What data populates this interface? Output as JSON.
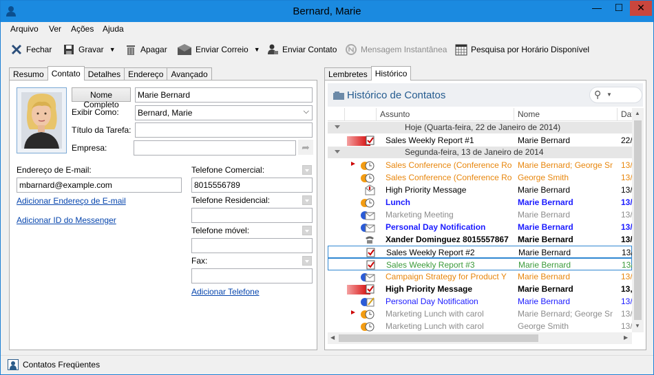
{
  "window": {
    "title": "Bernard, Marie",
    "minimize": "—",
    "maximize": "☐",
    "close": "✕"
  },
  "menu": [
    "Arquivo",
    "Ver",
    "Ações",
    "Ajuda"
  ],
  "toolbar": {
    "close": "Fechar",
    "save": "Gravar",
    "delete": "Apagar",
    "send_mail": "Enviar Correio",
    "send_contact": "Enviar Contato",
    "instant_message": "Mensagem Instantânea",
    "free_busy": "Pesquisa por Horário Disponível"
  },
  "left_tabs": [
    "Resumo",
    "Contato",
    "Detalhes",
    "Endereço",
    "Avançado"
  ],
  "contact": {
    "full_name_button": "Nome Completo",
    "full_name": "Marie Bernard",
    "display_as_label": "Exibir Como:",
    "display_as": "Bernard, Marie",
    "job_title_label": "Título da Tarefa:",
    "job_title": "",
    "company_label": "Empresa:",
    "company": "",
    "email_label": "Endereço de E-mail:",
    "email": "mbarnard@example.com",
    "add_email_link": "Adicionar Endereço de E-mail",
    "add_messenger_link": "Adicionar ID do Messenger",
    "business_phone_label": "Telefone Comercial:",
    "business_phone": "8015556789",
    "home_phone_label": "Telefone Residencial:",
    "home_phone": "",
    "mobile_phone_label": "Telefone móvel:",
    "mobile_phone": "",
    "fax_label": "Fax:",
    "fax": "",
    "add_phone_link": "Adicionar Telefone"
  },
  "right_tabs": [
    "Lembretes",
    "Histórico"
  ],
  "history": {
    "title": "Histórico de Contatos",
    "columns": {
      "subject": "Assunto",
      "name": "Nome",
      "date": "Dat"
    },
    "groups": [
      {
        "label": "Hoje (Quarta-feira, 22 de Janeiro de 2014)",
        "rows": [
          {
            "subject": "Sales Weekly Report #1",
            "name": "Marie Bernard",
            "date": "22/",
            "color": "#000000",
            "bold": false,
            "icon": "flag-task-icon"
          }
        ]
      },
      {
        "label": "Segunda-feira, 13 de Janeiro de 2014",
        "rows": [
          {
            "subject": "Sales Conference (Conference Roc",
            "name": "Marie Bernard;  George Sm",
            "date": "13/",
            "color": "#e8860c",
            "bold": false,
            "icon": "recurring-meeting-icon"
          },
          {
            "subject": "Sales Conference (Conference Roc",
            "name": "George Smith",
            "date": "13/",
            "color": "#e8860c",
            "bold": false,
            "icon": "meeting-icon"
          },
          {
            "subject": "High Priority Message",
            "name": "Marie Bernard",
            "date": "13/",
            "color": "#000000",
            "bold": false,
            "icon": "high-priority-mail-icon"
          },
          {
            "subject": "Lunch",
            "name": "Marie Bernard",
            "date": "13/",
            "color": "#1a1aff",
            "bold": true,
            "icon": "meeting-icon"
          },
          {
            "subject": "Marketing Meeting",
            "name": "Marie Bernard",
            "date": "13/",
            "color": "#8c8c8c",
            "bold": false,
            "icon": "mail-icon"
          },
          {
            "subject": "Personal Day Notification",
            "name": "Marie Bernard",
            "date": "13/",
            "color": "#1a1aff",
            "bold": true,
            "icon": "mail-icon"
          },
          {
            "subject": "Xander Dominguez 8015557867",
            "name": "Marie Bernard",
            "date": "13/",
            "color": "#000000",
            "bold": true,
            "icon": "phone-icon"
          },
          {
            "subject": "Sales Weekly Report #2",
            "name": "Marie Bernard",
            "date": "13/",
            "color": "#000000",
            "bold": false,
            "icon": "task-icon",
            "selected": true
          },
          {
            "subject": "Sales Weekly Report #3",
            "name": "Marie Bernard",
            "date": "13/",
            "color": "#3a9a3a",
            "bold": false,
            "icon": "task-icon",
            "selected": true
          },
          {
            "subject": "Campaign Strategy for Product Y",
            "name": "Marie Bernard",
            "date": "13/",
            "color": "#e8860c",
            "bold": false,
            "icon": "mail-icon"
          },
          {
            "subject": "High Priority Message",
            "name": "Marie Bernard",
            "date": "13,",
            "color": "#000000",
            "bold": true,
            "icon": "flag-task-icon"
          },
          {
            "subject": "Personal Day Notification",
            "name": "Marie Bernard",
            "date": "13/",
            "color": "#1a1aff",
            "bold": false,
            "icon": "note-icon"
          },
          {
            "subject": "Marketing Lunch with carol",
            "name": "Marie Bernard;  George Sm",
            "date": "13/",
            "color": "#8c8c8c",
            "bold": false,
            "icon": "recurring-meeting-icon"
          },
          {
            "subject": "Marketing Lunch with carol",
            "name": "George Smith",
            "date": "13/",
            "color": "#8c8c8c",
            "bold": false,
            "icon": "meeting-icon"
          }
        ]
      }
    ]
  },
  "status": {
    "text": "Contatos Freqüentes"
  }
}
